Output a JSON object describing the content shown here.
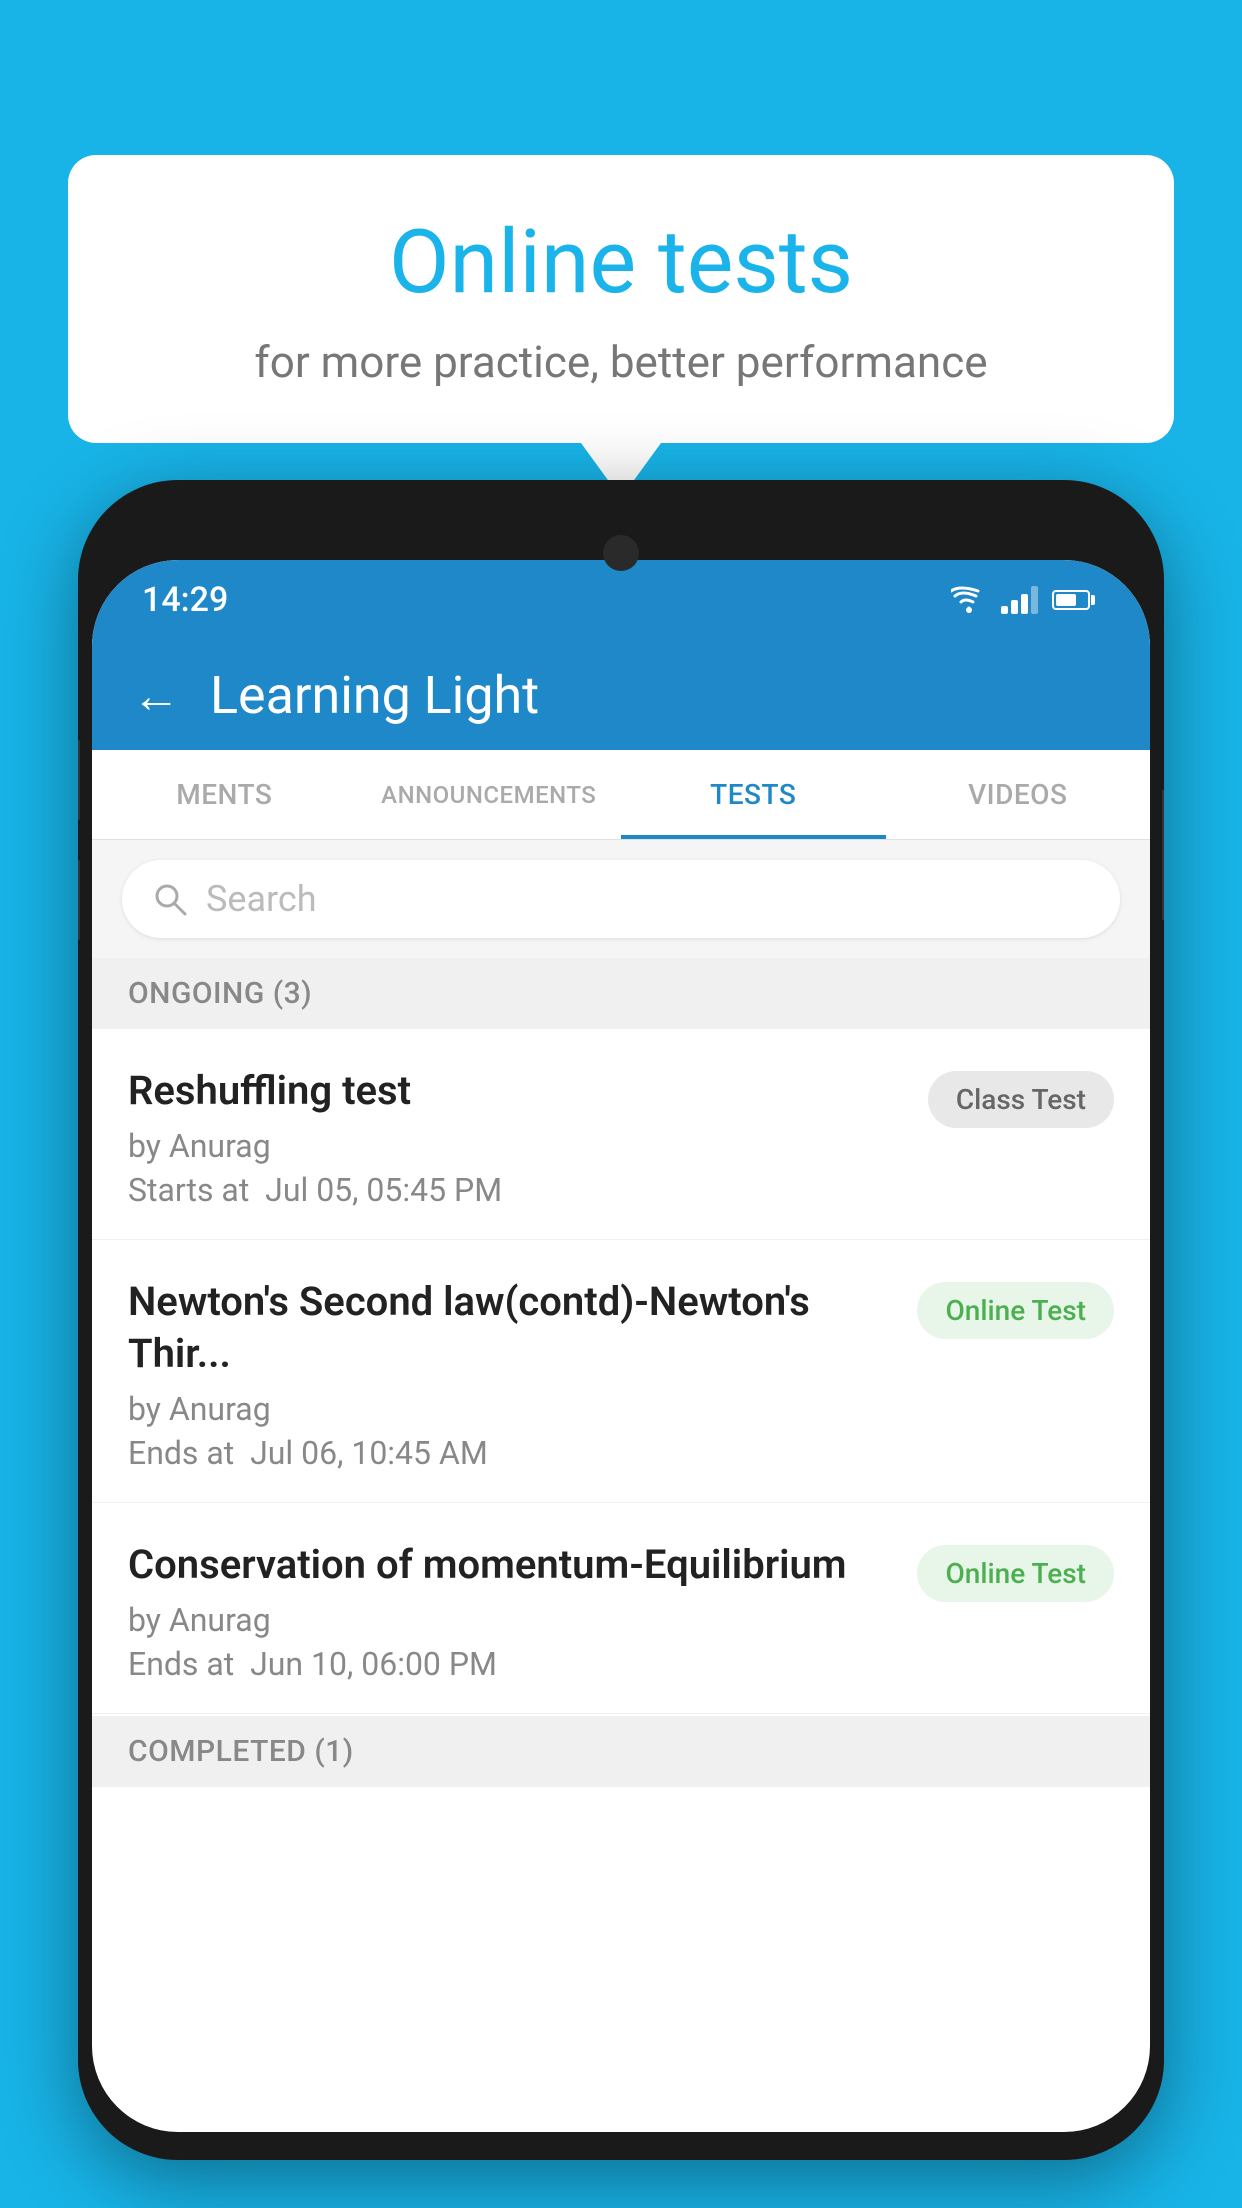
{
  "background_color": "#18b4e8",
  "speech_bubble": {
    "title": "Online tests",
    "subtitle": "for more practice, better performance"
  },
  "phone": {
    "status_bar": {
      "time": "14:29"
    },
    "app_header": {
      "title": "Learning Light"
    },
    "tabs": [
      {
        "id": "ments",
        "label": "MENTS",
        "active": false
      },
      {
        "id": "announcements",
        "label": "ANNOUNCEMENTS",
        "active": false
      },
      {
        "id": "tests",
        "label": "TESTS",
        "active": true
      },
      {
        "id": "videos",
        "label": "VIDEOS",
        "active": false
      }
    ],
    "search": {
      "placeholder": "Search"
    },
    "sections": [
      {
        "title": "ONGOING (3)",
        "tests": [
          {
            "name": "Reshuffling test",
            "by": "by Anurag",
            "time_label": "Starts at",
            "time": "Jul 05, 05:45 PM",
            "badge": "Class Test",
            "badge_type": "class"
          },
          {
            "name": "Newton's Second law(contd)-Newton's Thir...",
            "by": "by Anurag",
            "time_label": "Ends at",
            "time": "Jul 06, 10:45 AM",
            "badge": "Online Test",
            "badge_type": "online"
          },
          {
            "name": "Conservation of momentum-Equilibrium",
            "by": "by Anurag",
            "time_label": "Ends at",
            "time": "Jun 10, 06:00 PM",
            "badge": "Online Test",
            "badge_type": "online"
          }
        ]
      }
    ],
    "completed_section_title": "COMPLETED (1)"
  }
}
